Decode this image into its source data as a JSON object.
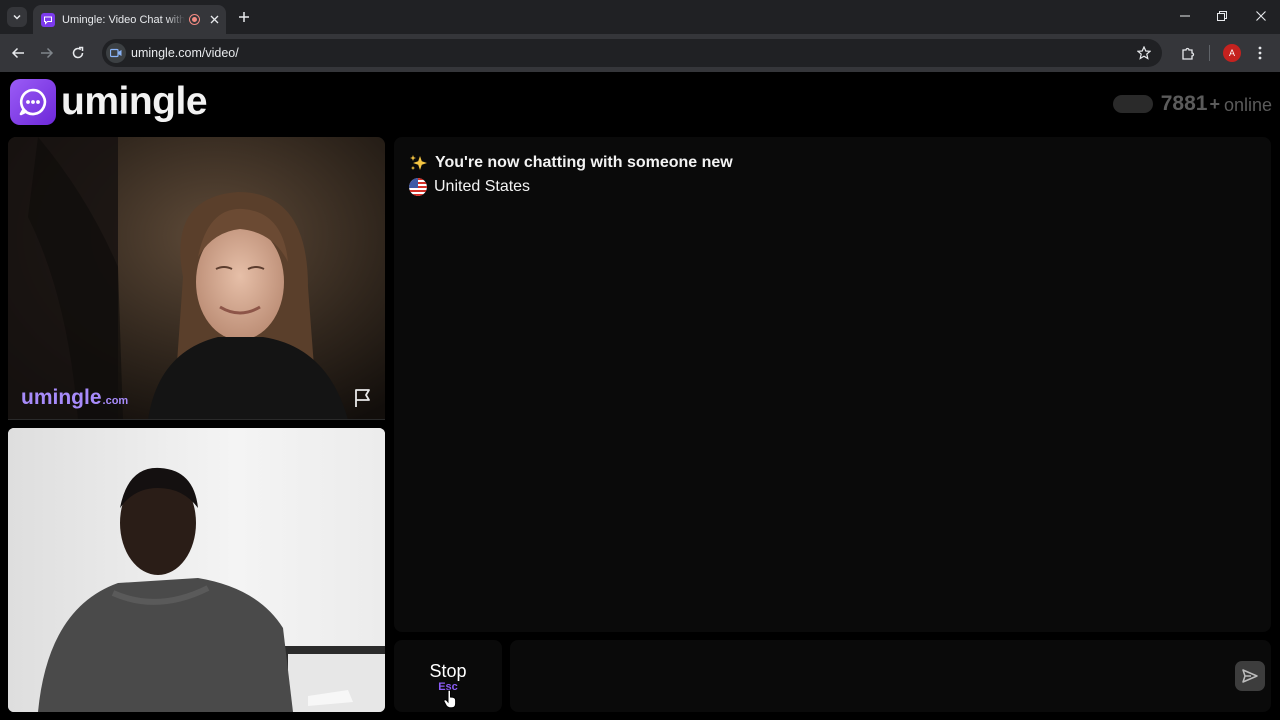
{
  "browser": {
    "tab_title": "Umingle: Video Chat with Strangers",
    "url": "umingle.com/video/",
    "profile_initial": "A"
  },
  "header": {
    "logo_text": "umingle",
    "online_count": "7881",
    "online_plus": "+",
    "online_label": "online"
  },
  "video": {
    "watermark_main": "umingle",
    "watermark_domain": ".com"
  },
  "chat": {
    "status": "You're now chatting with someone new",
    "country": "United States"
  },
  "controls": {
    "stop_label": "Stop",
    "stop_key": "Esc",
    "message_placeholder": ""
  },
  "colors": {
    "brand": "#8b5cf6",
    "panel": "#0a0a0a"
  },
  "icons": [
    "tab-list-icon",
    "chat-bubble-icon",
    "recording-icon",
    "close-icon",
    "plus-icon",
    "back-icon",
    "forward-icon",
    "reload-icon",
    "video-camera-icon",
    "star-icon",
    "extensions-icon",
    "menu-icon",
    "flag-icon",
    "send-icon",
    "sparkle-icon",
    "us-flag-icon"
  ]
}
